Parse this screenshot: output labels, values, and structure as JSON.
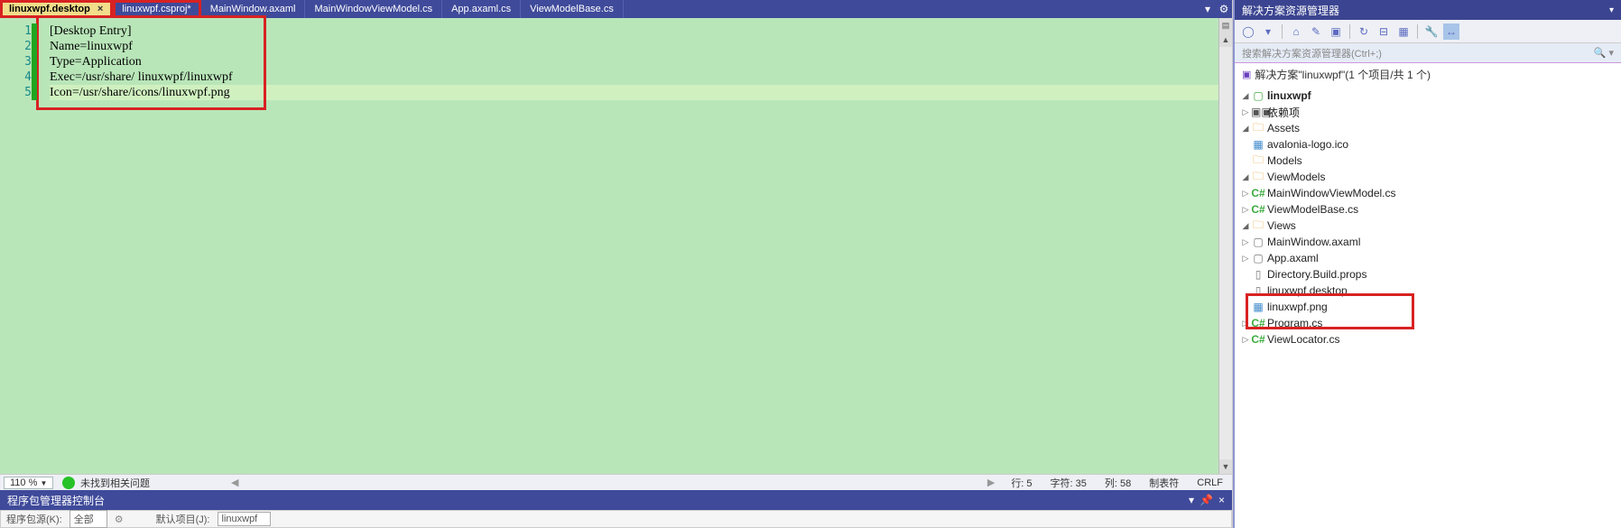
{
  "tabs": [
    {
      "label": "linuxwpf.desktop",
      "active": true,
      "close": "×"
    },
    {
      "label": "linuxwpf.csproj*"
    },
    {
      "label": "MainWindow.axaml"
    },
    {
      "label": "MainWindowViewModel.cs"
    },
    {
      "label": "App.axaml.cs"
    },
    {
      "label": "ViewModelBase.cs"
    }
  ],
  "gutter": [
    "1",
    "2",
    "3",
    "4",
    "5"
  ],
  "code": [
    "[Desktop Entry]",
    "Name=linuxwpf",
    "Type=Application",
    "Exec=/usr/share/ linuxwpf/linuxwpf",
    "Icon=/usr/share/icons/linuxwpf.png"
  ],
  "status": {
    "zoom": "110 %",
    "issues": "未找到相关问题",
    "line": "行: 5",
    "char": "字符: 35",
    "col": "列: 58",
    "ins": "制表符",
    "eol": "CRLF"
  },
  "pkg": {
    "title": "程序包管理器控制台",
    "src_label": "程序包源(K):",
    "src_value": "全部",
    "proj_label": "默认项目(J):",
    "proj_value": "linuxwpf"
  },
  "side": {
    "title": "解决方案资源管理器",
    "search_placeholder": "搜索解决方案资源管理器(Ctrl+;)",
    "sln": "解决方案\"linuxwpf\"(1 个项目/共 1 个)",
    "nodes": {
      "root": "linuxwpf",
      "deps": "依赖项",
      "assets": "Assets",
      "avalonia": "avalonia-logo.ico",
      "models": "Models",
      "vms": "ViewModels",
      "mwvm": "MainWindowViewModel.cs",
      "vmbase": "ViewModelBase.cs",
      "views": "Views",
      "mw": "MainWindow.axaml",
      "app": "App.axaml",
      "dbp": "Directory.Build.props",
      "desktop": "linuxwpf.desktop",
      "png": "linuxwpf.png",
      "prog": "Program.cs",
      "vloc": "ViewLocator.cs"
    }
  }
}
